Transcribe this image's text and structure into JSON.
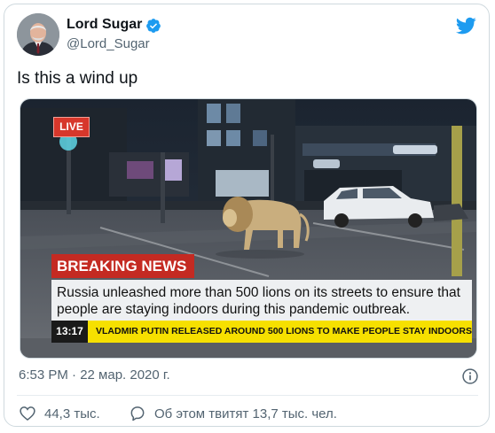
{
  "author": {
    "name": "Lord Sugar",
    "handle": "@Lord_Sugar"
  },
  "tweet": {
    "text": "Is this a wind up",
    "timestamp": "6:53 PM · 22 мар. 2020 г."
  },
  "media": {
    "live_label": "LIVE",
    "breaking_label": "BREAKING NEWS",
    "headline": "Russia unleashed more than 500 lions on its streets to ensure that people are staying indoors during this pandemic outbreak.",
    "ticker_time": "13:17",
    "ticker_text": "VLADMIR PUTIN RELEASED AROUND 500 LIONS TO MAKE PEOPLE STAY INDOORS"
  },
  "actions": {
    "likes": "44,3 тыс.",
    "discussing": "Об этом твитят 13,7 тыс. чел."
  },
  "colors": {
    "twitter_blue": "#1d9bf0",
    "breaking_red": "#c42a22",
    "ticker_yellow": "#f6e000",
    "live_red": "#d7372b",
    "muted_text": "#536471"
  }
}
